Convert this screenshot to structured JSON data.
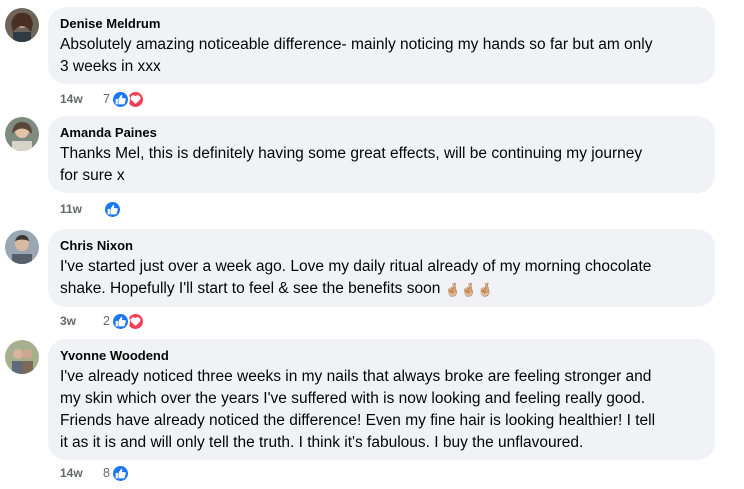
{
  "comments": [
    {
      "author": "Denise Meldrum",
      "text": "Absolutely amazing noticeable difference- mainly noticing my hands so far but am only\n3 weeks in xxx",
      "time": "14w",
      "reaction_count": "7",
      "reactions": [
        "like-icon",
        "love-icon"
      ]
    },
    {
      "author": "Amanda Paines",
      "text": "Thanks Mel, this is definitely having some great effects, will be continuing my journey\nfor sure x",
      "time": "11w",
      "reaction_count": "",
      "reactions": [
        "like-icon"
      ]
    },
    {
      "author": "Chris Nixon",
      "text": "I've started just over a week ago. Love my daily ritual already of my morning chocolate\nshake. Hopefully I'll start to feel & see the benefits soon",
      "emoji": "🤞🏼🤞🏼🤞🏼",
      "time": "3w",
      "reaction_count": "2",
      "reactions": [
        "like-icon",
        "love-icon"
      ]
    },
    {
      "author": "Yvonne Woodend",
      "text": "I've already noticed three weeks in my nails that always broke are feeling stronger and\nmy skin which over the years I've suffered with is now looking and feeling really good.\nFriends have already noticed the difference! Even my fine hair is looking healthier! I tell\nit as it is and will only tell the truth. I think it's fabulous. I buy the unflavoured.",
      "time": "14w",
      "reaction_count": "8",
      "reactions": [
        "like-icon"
      ]
    }
  ],
  "colors": {
    "bubble_bg": "#f0f2f5",
    "like": "#1877f2",
    "love": "#f33e58",
    "meta_text": "#65676b"
  }
}
